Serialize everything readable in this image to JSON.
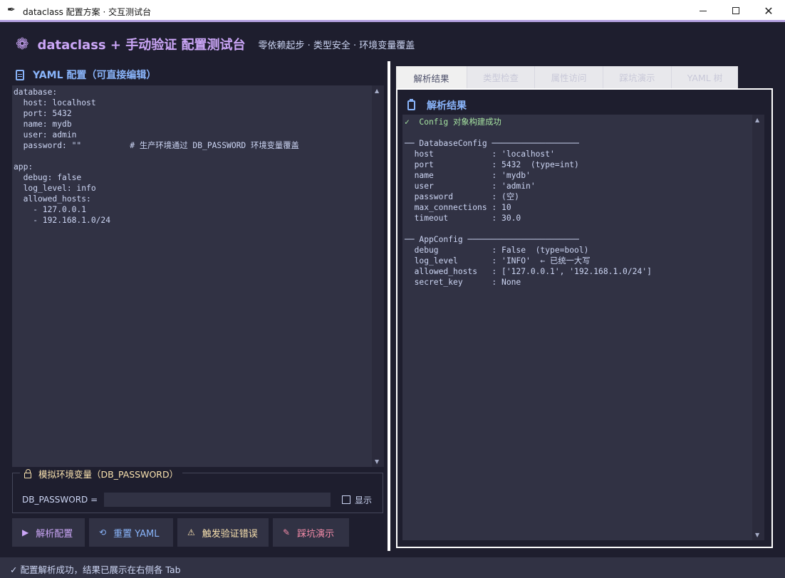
{
  "window": {
    "title": "dataclass 配置方案 · 交互测试台",
    "icon": "feather-icon",
    "close_glyph": "✕"
  },
  "header": {
    "title": "dataclass + 手动验证 配置测试台",
    "subtitle": "零依赖起步 · 类型安全 · 环境变量覆盖",
    "icon": "gear-icon"
  },
  "editor": {
    "title": "YAML 配置（可直接编辑）",
    "content": "database:\n  host: localhost\n  port: 5432\n  name: mydb\n  user: admin\n  password: \"\"          # 生产环境通过 DB_PASSWORD 环境变量覆盖\n\napp:\n  debug: false\n  log_level: info\n  allowed_hosts:\n    - 127.0.0.1\n    - 192.168.1.0/24"
  },
  "env": {
    "legend": "模拟环境变量（DB_PASSWORD）",
    "label": "DB_PASSWORD =",
    "value": "",
    "show_label": "显示"
  },
  "buttons": {
    "parse": "解析配置",
    "reset": "重置 YAML",
    "error": "触发验证错误",
    "pitfall": "踩坑演示"
  },
  "tabs": [
    "解析结果",
    "类型检查",
    "属性访问",
    "踩坑演示",
    "YAML 树"
  ],
  "results": {
    "title": "解析结果",
    "success_line": "✓  Config 对象构建成功",
    "body": "\n── DatabaseConfig ──────────────────\n  host            : 'localhost'\n  port            : 5432  (type=int)\n  name            : 'mydb'\n  user            : 'admin'\n  password        : (空)\n  max_connections : 10\n  timeout         : 30.0\n\n── AppConfig ───────────────────────\n  debug           : False  (type=bool)\n  log_level       : 'INFO'  ← 已统一大写\n  allowed_hosts   : ['127.0.0.1', '192.168.1.0/24']\n  secret_key      : None"
  },
  "status": "✓  配置解析成功，结果已展示在右侧各 Tab",
  "colors": {
    "background": "#1e1e2e",
    "surface": "#313244",
    "accent_purple": "#cba6f7",
    "accent_blue": "#89b4fa",
    "accent_yellow": "#f9e2af",
    "accent_red": "#f38ba8",
    "success_green": "#a6e3a1"
  }
}
